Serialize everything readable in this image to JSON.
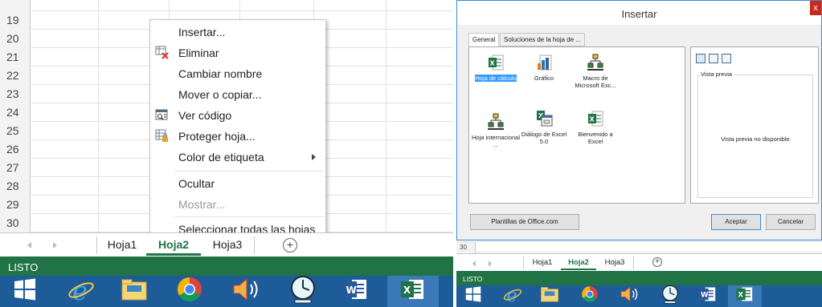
{
  "left": {
    "rows": [
      "19",
      "20",
      "21",
      "22",
      "23",
      "24",
      "25",
      "26",
      "27",
      "28",
      "29",
      "30"
    ],
    "context_menu": {
      "items": [
        {
          "label": "Insertar...",
          "icon": "",
          "disabled": false,
          "submenu": false
        },
        {
          "label": "Eliminar",
          "icon": "delete-sheet-icon",
          "disabled": false,
          "submenu": false
        },
        {
          "label": "Cambiar nombre",
          "icon": "",
          "disabled": false,
          "submenu": false
        },
        {
          "label": "Mover o copiar...",
          "icon": "",
          "disabled": false,
          "submenu": false
        },
        {
          "label": "Ver código",
          "icon": "view-code-icon",
          "disabled": false,
          "submenu": false
        },
        {
          "label": "Proteger hoja...",
          "icon": "protect-sheet-icon",
          "disabled": false,
          "submenu": false
        },
        {
          "label": "Color de etiqueta",
          "icon": "",
          "disabled": false,
          "submenu": true
        },
        {
          "label": "Ocultar",
          "icon": "",
          "disabled": false,
          "submenu": false
        },
        {
          "label": "Mostrar...",
          "icon": "",
          "disabled": true,
          "submenu": false
        },
        {
          "label": "Seleccionar todas las hojas",
          "icon": "",
          "disabled": false,
          "submenu": false
        }
      ]
    },
    "sheet_tabs": [
      "Hoja1",
      "Hoja2",
      "Hoja3"
    ],
    "active_tab": "Hoja2",
    "add_sheet": "+",
    "status": "LISTO"
  },
  "right": {
    "dialog": {
      "title": "Insertar",
      "close": "x",
      "tabs": [
        "General",
        "Soluciones de la hoja de ..."
      ],
      "items": [
        {
          "label": "Hoja de cálculo",
          "icon": "worksheet-icon",
          "selected": true
        },
        {
          "label": "Gráfico",
          "icon": "chart-icon",
          "selected": false
        },
        {
          "label": "Macro de Microsoft Exc...",
          "icon": "macro-icon",
          "selected": false
        },
        {
          "label": "Hoja internacional ...",
          "icon": "intl-macro-icon",
          "selected": false
        },
        {
          "label": "Diálogo de Excel 5.0",
          "icon": "dialog-icon",
          "selected": false
        },
        {
          "label": "Bienvenido a Excel",
          "icon": "worksheet-icon",
          "selected": false
        }
      ],
      "preview_label": "Vista previa",
      "preview_message": "Vista previa no disponible.",
      "office_templates_button": "Plantillas de Office.com",
      "ok_button": "Aceptar",
      "cancel_button": "Cancelar"
    },
    "row": "30",
    "sheet_tabs": [
      "Hoja1",
      "Hoja2",
      "Hoja3"
    ],
    "active_tab": "Hoja2",
    "status": "LISTO"
  },
  "taskbar": {
    "apps": [
      "start-icon",
      "ie-icon",
      "explorer-icon",
      "chrome-icon",
      "volume-icon",
      "clock-icon",
      "word-icon",
      "excel-icon"
    ]
  },
  "colors": {
    "excel_green": "#217346",
    "taskbar_blue": "#1d5c99",
    "selection_blue": "#3399ff"
  }
}
